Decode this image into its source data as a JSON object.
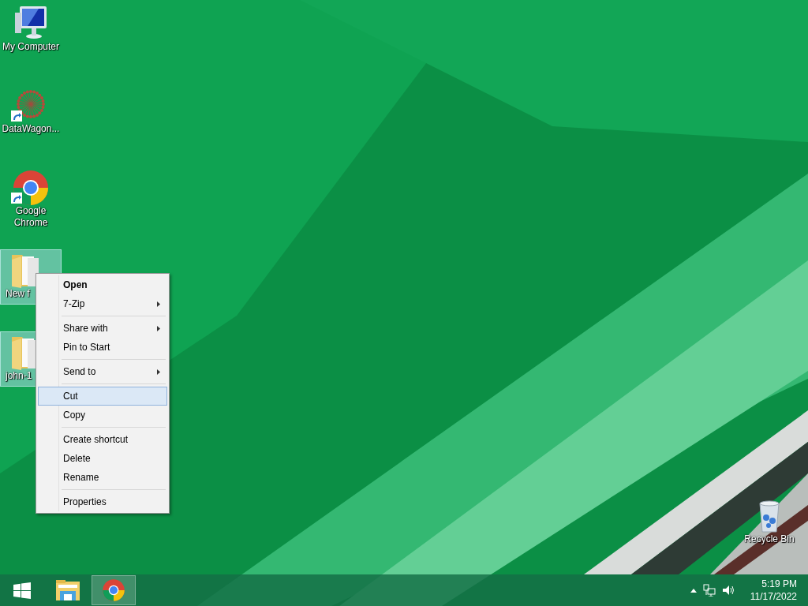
{
  "desktop_icons": [
    {
      "kind": "computer",
      "label": "My Computer",
      "selected": false,
      "shortcut": false
    },
    {
      "kind": "app",
      "label": "DataWagon...",
      "selected": false,
      "shortcut": true
    },
    {
      "kind": "chrome",
      "label": "Google Chrome",
      "selected": false,
      "shortcut": true
    },
    {
      "kind": "folder",
      "label": "New f",
      "selected": true,
      "shortcut": false
    },
    {
      "kind": "folder",
      "label": "john-1",
      "selected": true,
      "shortcut": false
    }
  ],
  "recycle_bin": {
    "label": "Recycle Bin"
  },
  "context_menu": {
    "groups": [
      [
        {
          "label": "Open",
          "default": true,
          "submenu": false,
          "selected": false
        },
        {
          "label": "7-Zip",
          "default": false,
          "submenu": true,
          "selected": false
        }
      ],
      [
        {
          "label": "Share with",
          "default": false,
          "submenu": true,
          "selected": false
        },
        {
          "label": "Pin to Start",
          "default": false,
          "submenu": false,
          "selected": false
        }
      ],
      [
        {
          "label": "Send to",
          "default": false,
          "submenu": true,
          "selected": false
        }
      ],
      [
        {
          "label": "Cut",
          "default": false,
          "submenu": false,
          "selected": true
        },
        {
          "label": "Copy",
          "default": false,
          "submenu": false,
          "selected": false
        }
      ],
      [
        {
          "label": "Create shortcut",
          "default": false,
          "submenu": false,
          "selected": false
        },
        {
          "label": "Delete",
          "default": false,
          "submenu": false,
          "selected": false
        },
        {
          "label": "Rename",
          "default": false,
          "submenu": false,
          "selected": false
        }
      ],
      [
        {
          "label": "Properties",
          "default": false,
          "submenu": false,
          "selected": false
        }
      ]
    ]
  },
  "taskbar": {
    "items": [
      {
        "kind": "start",
        "selected": false
      },
      {
        "kind": "explorer",
        "selected": false
      },
      {
        "kind": "chrome",
        "selected": true
      }
    ],
    "clock": {
      "time": "5:19 PM",
      "date": "11/17/2022"
    }
  }
}
